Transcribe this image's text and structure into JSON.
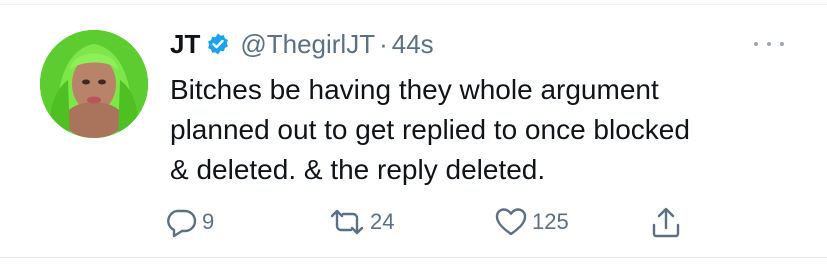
{
  "tweet": {
    "author_name": "JT",
    "author_handle": "@ThegirlJT",
    "separator": "·",
    "timestamp": "44s",
    "text_lines": [
      "Bitches be having they whole argument",
      "planned out to get replied to once blocked",
      "& deleted. & the reply deleted."
    ],
    "verified": true
  },
  "actions": {
    "reply_count": "9",
    "retweet_count": "24",
    "like_count": "125"
  },
  "icons": {
    "verified": "verified-badge-icon",
    "more": "more-options-icon",
    "reply": "reply-icon",
    "retweet": "retweet-icon",
    "like": "heart-icon",
    "share": "share-icon"
  },
  "colors": {
    "text": "#0f1419",
    "secondary": "#5b7083",
    "verified_blue": "#1da1f2",
    "avatar_green": "#56c92d"
  }
}
